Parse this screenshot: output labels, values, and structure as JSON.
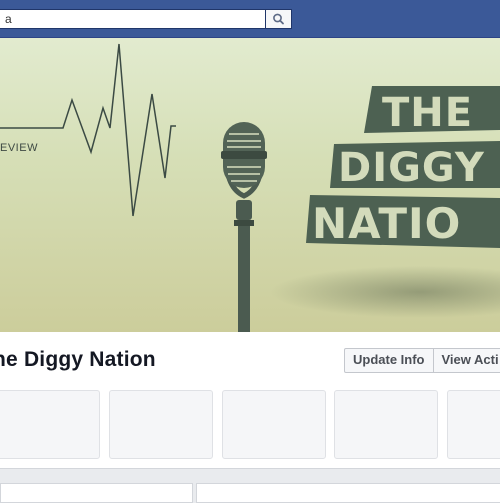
{
  "search": {
    "value": "a"
  },
  "cover": {
    "left_text": "EVIEW",
    "title_lines": [
      "THE",
      "DIGGY",
      "NATIO"
    ]
  },
  "page": {
    "name": "he Diggy Nation"
  },
  "actions": {
    "update_info": "Update Info",
    "view_activity": "View Acti"
  },
  "colors": {
    "header": "#3b5998",
    "cover_top": "#e2ebcf",
    "cover_bottom": "#cccd9b",
    "logo": "#4d6152"
  }
}
